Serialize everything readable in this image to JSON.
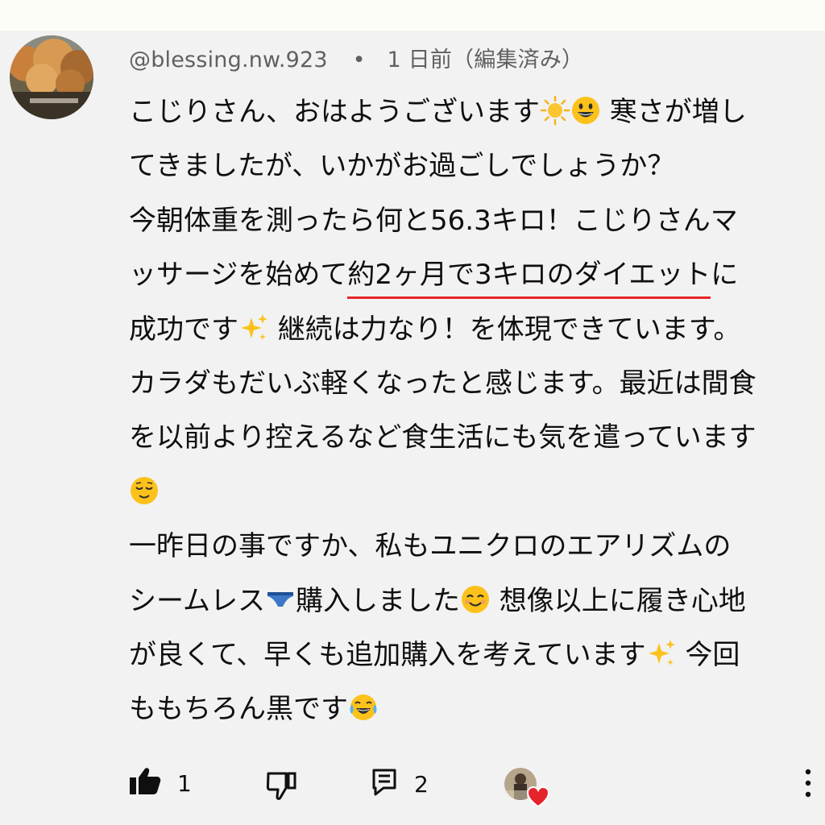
{
  "comment": {
    "author": "@blessing.nw.923",
    "separator": "•",
    "timestamp": "1 日前（編集済み）",
    "lines": [
      [
        "こじりさん、おはようございます",
        "sun-emoji",
        "grin-emoji",
        " 寒さが増し"
      ],
      [
        "てきましたが、いかがお過ごしでしょうか？"
      ],
      [
        "今朝体重を測ったら何と56.3キロ！こじりさんマ"
      ],
      [
        "ッサージを始めて",
        "約2ヶ月で3キロのダイエット",
        "に"
      ],
      [
        "成功です",
        "sparkles-emoji",
        " 継続は力なり！を体現できています。"
      ],
      [
        "カラダもだいぶ軽くなったと感じます。最近は間食"
      ],
      [
        "を以前より控えるなど食生活にも気を遣っています"
      ],
      [
        "relieved-emoji"
      ],
      [
        "一昨日の事ですか、私もユニクロのエアリズムの"
      ],
      [
        "シームレス",
        "briefs-emoji",
        "購入しました",
        "smile-emoji",
        " 想像以上に履き心地"
      ],
      [
        "が良くて、早くも追加購入を考えています",
        "sparkles-emoji",
        " 今回"
      ],
      [
        "ももちろん黒です",
        "tears-of-joy-emoji"
      ]
    ],
    "highlight": "約2ヶ月で3キロのダイエット",
    "highlight_color": "#e8262a"
  },
  "actions": {
    "like_count": "1",
    "reply_count": "2"
  },
  "icons": {
    "like": "thumbs-up-icon",
    "dislike": "thumbs-down-icon",
    "reply": "reply-icon",
    "heart": "heart-icon",
    "more": "more-vert-icon"
  }
}
